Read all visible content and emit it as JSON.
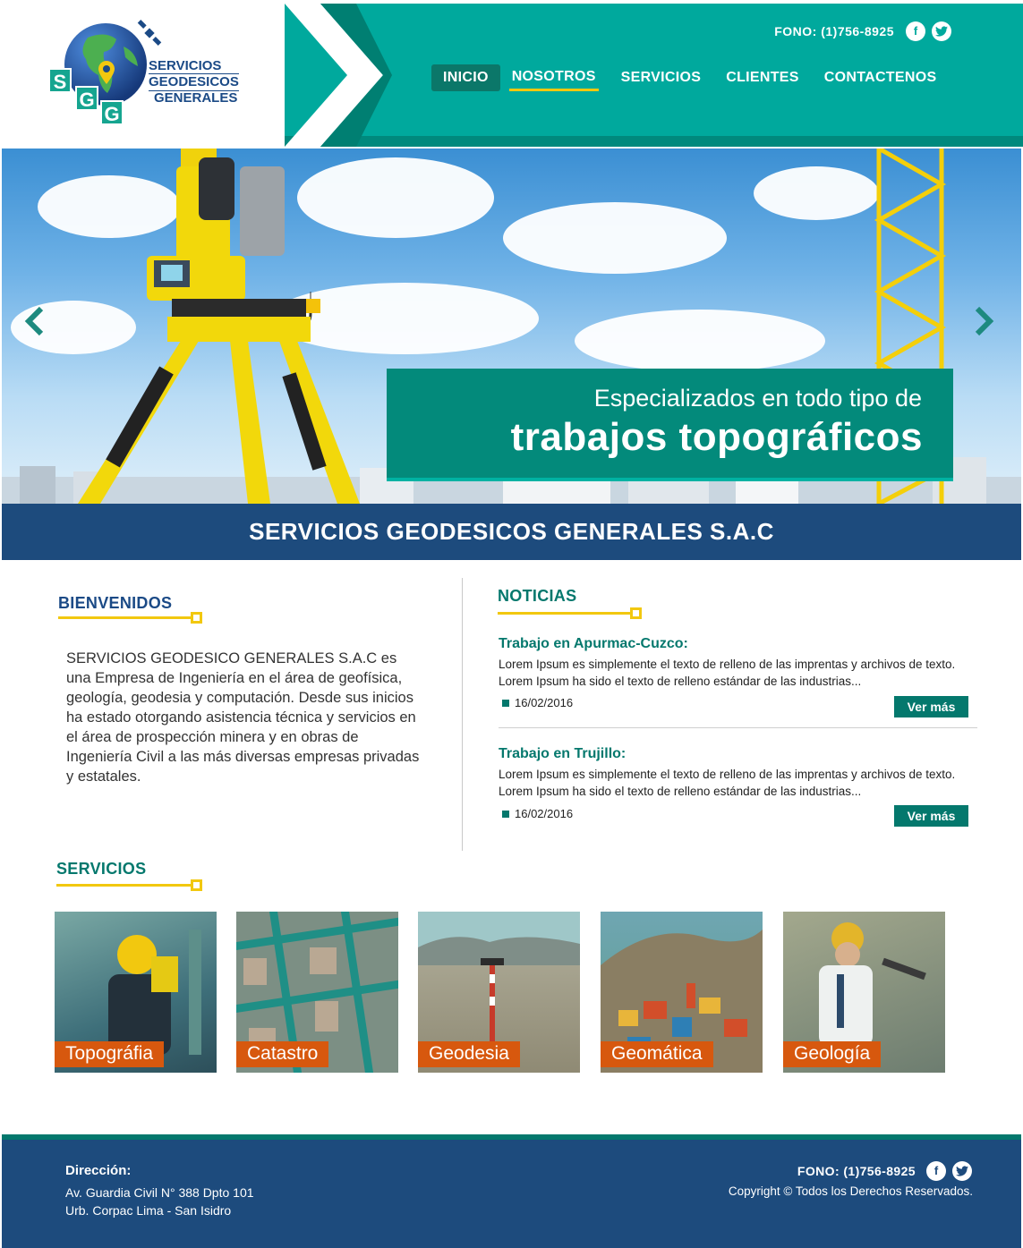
{
  "brand": {
    "logo_letters": [
      "S",
      "G",
      "G"
    ],
    "logo_lines": [
      "SERVICIOS",
      "GEODESICOS",
      "GENERALES"
    ],
    "colors": {
      "teal": "#00a99d",
      "dark_teal": "#04786d",
      "navy": "#1d4b7d",
      "yellow": "#f2c80f",
      "orange": "#d7580e"
    }
  },
  "header": {
    "phone": "FONO: (1)756-8925",
    "social": [
      {
        "icon": "facebook-icon",
        "glyph": "f"
      },
      {
        "icon": "twitter-icon",
        "glyph": "t"
      }
    ],
    "nav": [
      {
        "label": "INICIO",
        "state": "active"
      },
      {
        "label": "NOSOTROS",
        "state": "underlined"
      },
      {
        "label": "SERVICIOS",
        "state": ""
      },
      {
        "label": "CLIENTES",
        "state": ""
      },
      {
        "label": "CONTACTENOS",
        "state": ""
      }
    ]
  },
  "hero": {
    "subtitle": "Especializados en todo tipo de",
    "title": "trabajos topográficos",
    "prev_icon": "chevron-left-icon",
    "next_icon": "chevron-right-icon"
  },
  "banner": {
    "text": "SERVICIOS GEODESICOS GENERALES S.A.C"
  },
  "welcome": {
    "title": "BIENVENIDOS",
    "body": "SERVICIOS GEODESICO GENERALES S.A.C es una Empresa de Ingeniería en el área de geofísica, geología, geodesia y computación. Desde sus inicios ha estado otorgando asistencia técnica y servicios en el área de prospección minera y en obras de Ingeniería Civil a las más diversas empresas privadas y estatales."
  },
  "news": {
    "title": "NOTICIAS",
    "items": [
      {
        "title": "Trabajo en Apurmac-Cuzco:",
        "body": "Lorem Ipsum es simplemente el texto de relleno de las imprentas y archivos de texto. Lorem Ipsum ha sido el texto de relleno estándar de las industrias...",
        "date": "16/02/2016",
        "button": "Ver más"
      },
      {
        "title": "Trabajo en Trujillo:",
        "body": "Lorem Ipsum es simplemente el texto de relleno de las imprentas y archivos de texto. Lorem Ipsum ha sido el texto de relleno estándar de las industrias...",
        "date": "16/02/2016",
        "button": "Ver más"
      }
    ]
  },
  "services": {
    "title": "SERVICIOS",
    "items": [
      {
        "label": "Topográfia"
      },
      {
        "label": "Catastro"
      },
      {
        "label": "Geodesia"
      },
      {
        "label": "Geomática"
      },
      {
        "label": "Geología"
      }
    ]
  },
  "footer": {
    "address_title": "Dirección:",
    "address_line1": "Av. Guardia Civil N° 388 Dpto 101",
    "address_line2": "Urb. Corpac Lima - San Isidro",
    "phone": "FONO: (1)756-8925",
    "copyright": "Copyright © Todos los Derechos Reservados."
  }
}
